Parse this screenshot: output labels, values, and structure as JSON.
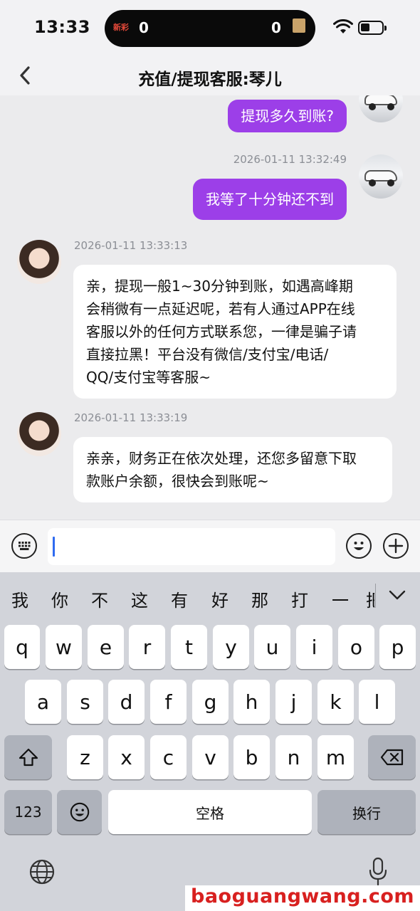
{
  "status_bar": {
    "time": "13:33",
    "island_left_count": "0",
    "island_right_count": "0",
    "island_game_text": "新彩",
    "battery_level_fraction": 0.45
  },
  "nav": {
    "title": "充值/提现客服:琴儿"
  },
  "messages": [
    {
      "side": "right",
      "text": "提现多久到账?"
    },
    {
      "side": "right",
      "time": "2026-01-11 13:32:49",
      "text": "我等了十分钟还不到"
    },
    {
      "side": "left",
      "time": "2026-01-11 13:33:13",
      "lines": [
        "亲，提现一般1~30分钟到账，如遇高峰期",
        "会稍微有一点延迟呢，若有人通过APP在线",
        "客服以外的任何方式联系您，一律是骗子请",
        "直接拉黑！平台没有微信/支付宝/电话/",
        "QQ/支付宝等客服~"
      ]
    },
    {
      "side": "left",
      "time": "2026-01-11 13:33:19",
      "lines": [
        "亲亲，财务正在依次处理，还您多留意下取",
        "款账户余额，很快会到账呢~"
      ]
    }
  ],
  "input": {
    "value": "",
    "placeholder": ""
  },
  "candidates": [
    "我",
    "你",
    "不",
    "这",
    "有",
    "好",
    "那",
    "打",
    "一",
    "把"
  ],
  "keyboard": {
    "row1": [
      "q",
      "w",
      "e",
      "r",
      "t",
      "y",
      "u",
      "i",
      "o",
      "p"
    ],
    "row2": [
      "a",
      "s",
      "d",
      "f",
      "g",
      "h",
      "j",
      "k",
      "l"
    ],
    "row3": [
      "z",
      "x",
      "c",
      "v",
      "b",
      "n",
      "m"
    ],
    "num_key": "123",
    "space_key": "空格",
    "return_key": "换行"
  },
  "watermark": "baoguangwang.com",
  "icons": {
    "back": "chevron-left-icon",
    "keyboard_toggle": "keyboard-icon",
    "emoji": "smiley-icon",
    "add": "plus-icon",
    "shift": "shift-icon",
    "delete": "backspace-icon",
    "emoji_key": "emoji-icon",
    "globe": "globe-icon",
    "mic": "microphone-icon",
    "wifi": "wifi-icon",
    "battery": "battery-icon"
  },
  "colors": {
    "outgoing_bubble": "#9c3fe8",
    "incoming_bubble": "#ffffff",
    "timestamp": "#8b8e95",
    "caret": "#2f6bf0",
    "watermark": "#d8201f"
  }
}
